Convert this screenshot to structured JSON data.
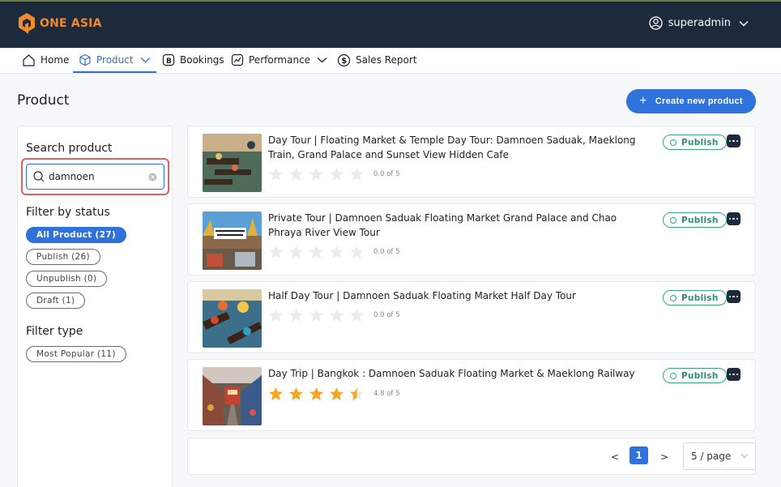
{
  "brand": {
    "name": "ONE ASIA",
    "accent": "#f08a2c"
  },
  "user": {
    "name": "superadmin"
  },
  "nav": [
    {
      "label": "Home",
      "icon": "home-icon"
    },
    {
      "label": "Product",
      "icon": "box-icon",
      "active": true
    },
    {
      "label": "Bookings",
      "icon": "bookings-icon"
    },
    {
      "label": "Performance",
      "icon": "performance-icon"
    },
    {
      "label": "Sales Report",
      "icon": "dollar-icon"
    }
  ],
  "page": {
    "title": "Product",
    "create_label": "Create new product"
  },
  "sidebar": {
    "search_title": "Search product",
    "search_value": "damnoen",
    "status_title": "Filter by status",
    "statuses": [
      "All Product (27)",
      "Publish (26)",
      "Unpublish (0)",
      "Draft (1)"
    ],
    "type_title": "Filter type",
    "types": [
      "Most Popular (11)"
    ]
  },
  "products": [
    {
      "title": "Day Tour | Floating Market & Temple Day Tour: Damnoen Saduak, Maeklong Train, Grand Palace and Sunset View Hidden Cafe",
      "rating": 0.0,
      "rating_text": "0.0 of 5",
      "status": "Publish"
    },
    {
      "title": "Private Tour | Damnoen Saduak Floating Market Grand Palace and Chao Phraya River View Tour",
      "rating": 0.0,
      "rating_text": "0.0 of 5",
      "status": "Publish"
    },
    {
      "title": "Half Day Tour | Damnoen Saduak Floating Market Half Day Tour",
      "rating": 0.0,
      "rating_text": "0.0 of 5",
      "status": "Publish"
    },
    {
      "title": "Day Trip | Bangkok : Damnoen Saduak Floating Market & Maeklong Railway",
      "rating": 4.8,
      "rating_text": "4.8 of 5",
      "status": "Publish"
    }
  ],
  "pagination": {
    "prev": "<",
    "current": "1",
    "next": ">",
    "page_size": "5 / page"
  }
}
